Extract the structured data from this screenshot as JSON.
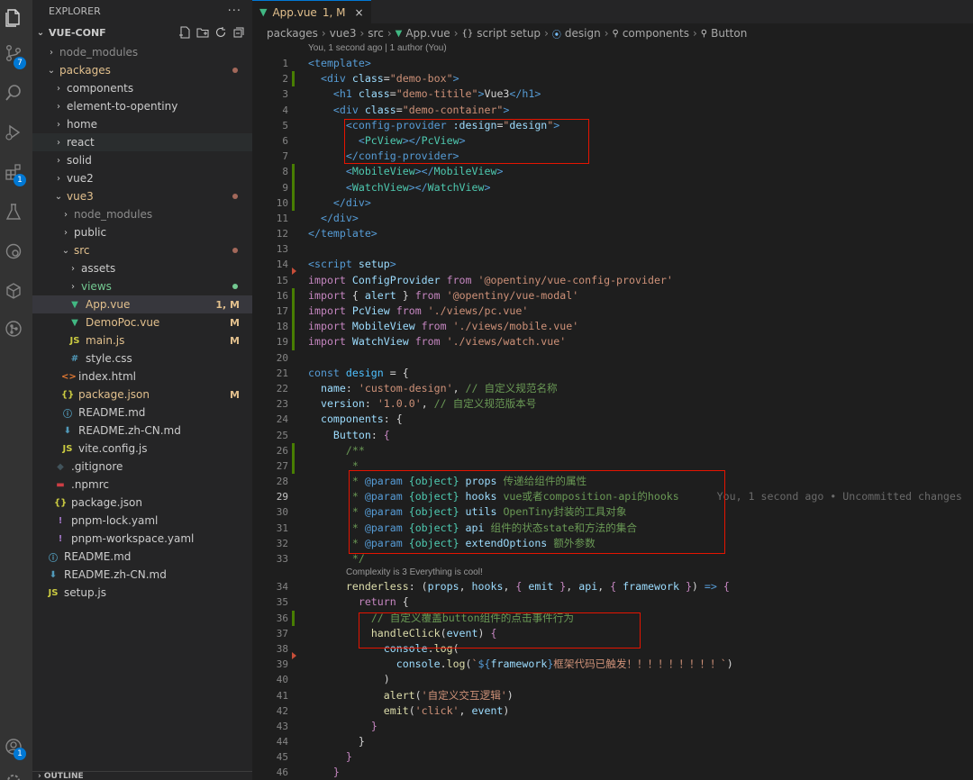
{
  "colors": {
    "accent": "#0078d4",
    "modified": "#e2c08d",
    "added": "#73c991",
    "error_box": "#e51400"
  },
  "activity_bar": {
    "items": [
      {
        "name": "explorer-icon"
      },
      {
        "name": "source-control-icon",
        "badge": "7"
      },
      {
        "name": "search-icon"
      },
      {
        "name": "run-debug-icon"
      },
      {
        "name": "extensions-icon",
        "badge": "1"
      },
      {
        "name": "testing-icon"
      },
      {
        "name": "remote-icon"
      },
      {
        "name": "docker-icon"
      },
      {
        "name": "git-graph-icon"
      }
    ],
    "account_badge": "1"
  },
  "explorer": {
    "title": "EXPLORER",
    "more": "···",
    "root": "VUE-CONF",
    "outline": "OUTLINE",
    "tree": [
      {
        "label": "node_modules",
        "type": "folder",
        "open": false,
        "depth": 1,
        "color": "#8c8c8c"
      },
      {
        "label": "packages",
        "type": "folder",
        "open": true,
        "depth": 1,
        "color": "#e2c08d",
        "dot": "#a3685a"
      },
      {
        "label": "components",
        "type": "folder",
        "open": false,
        "depth": 2
      },
      {
        "label": "element-to-opentiny",
        "type": "folder",
        "open": false,
        "depth": 2
      },
      {
        "label": "home",
        "type": "folder",
        "open": false,
        "depth": 2
      },
      {
        "label": "react",
        "type": "folder",
        "open": false,
        "depth": 2,
        "hover": true
      },
      {
        "label": "solid",
        "type": "folder",
        "open": false,
        "depth": 2
      },
      {
        "label": "vue2",
        "type": "folder",
        "open": false,
        "depth": 2
      },
      {
        "label": "vue3",
        "type": "folder",
        "open": true,
        "depth": 2,
        "color": "#e2c08d",
        "dot": "#a3685a"
      },
      {
        "label": "node_modules",
        "type": "folder",
        "open": false,
        "depth": 3,
        "color": "#8c8c8c"
      },
      {
        "label": "public",
        "type": "folder",
        "open": false,
        "depth": 3
      },
      {
        "label": "src",
        "type": "folder",
        "open": true,
        "depth": 3,
        "color": "#e2c08d",
        "dot": "#a3685a"
      },
      {
        "label": "assets",
        "type": "folder",
        "open": false,
        "depth": 4
      },
      {
        "label": "views",
        "type": "folder",
        "open": false,
        "depth": 4,
        "color": "#73c991",
        "dot": "#73c991"
      },
      {
        "label": "App.vue",
        "type": "vue",
        "depth": 4,
        "color": "#e2c08d",
        "status": "1, M",
        "selected": true
      },
      {
        "label": "DemoPoc.vue",
        "type": "vue",
        "depth": 4,
        "color": "#e2c08d",
        "status": "M"
      },
      {
        "label": "main.js",
        "type": "js",
        "depth": 4,
        "color": "#e2c08d",
        "status": "M"
      },
      {
        "label": "style.css",
        "type": "css",
        "depth": 4
      },
      {
        "label": "index.html",
        "type": "html",
        "depth": 3
      },
      {
        "label": "package.json",
        "type": "json",
        "depth": 3,
        "color": "#e2c08d",
        "status": "M"
      },
      {
        "label": "README.md",
        "type": "info",
        "depth": 3
      },
      {
        "label": "README.zh-CN.md",
        "type": "md",
        "depth": 3
      },
      {
        "label": "vite.config.js",
        "type": "js",
        "depth": 3
      },
      {
        "label": ".gitignore",
        "type": "git",
        "depth": 2
      },
      {
        "label": ".npmrc",
        "type": "npm",
        "depth": 2
      },
      {
        "label": "package.json",
        "type": "json",
        "depth": 2
      },
      {
        "label": "pnpm-lock.yaml",
        "type": "yaml",
        "depth": 2
      },
      {
        "label": "pnpm-workspace.yaml",
        "type": "yaml",
        "depth": 2
      },
      {
        "label": "README.md",
        "type": "info",
        "depth": 1
      },
      {
        "label": "README.zh-CN.md",
        "type": "md",
        "depth": 1
      },
      {
        "label": "setup.js",
        "type": "js",
        "depth": 1
      }
    ]
  },
  "editor": {
    "tab": {
      "label": "App.vue",
      "status": "1, M",
      "close": "×"
    },
    "breadcrumb": [
      "packages",
      "vue3",
      "src",
      "App.vue",
      "script setup",
      "design",
      "components",
      "Button"
    ],
    "blame_header": "You, 1 second ago | 1 author (You)",
    "codelens": "Complexity is 3 Everything is cool!",
    "current_line_blame": "You, 1 second ago • Uncommitted changes",
    "lines": [
      {
        "n": "1",
        "html": "<span class='tg'>&lt;template&gt;</span>"
      },
      {
        "n": "2",
        "gm": "m",
        "html": "  <span class='tg'>&lt;div</span> <span class='an'>class</span><span class='tx'>=</span><span class='st'>\"demo-box\"</span><span class='tg'>&gt;</span>"
      },
      {
        "n": "3",
        "html": "    <span class='tg'>&lt;h1</span> <span class='an'>class</span><span class='tx'>=</span><span class='st'>\"demo-titile\"</span><span class='tg'>&gt;</span><span class='tx'>Vue3</span><span class='tg'>&lt;/h1&gt;</span>"
      },
      {
        "n": "4",
        "html": "    <span class='tg'>&lt;div</span> <span class='an'>class</span><span class='tx'>=</span><span class='st'>\"demo-container\"</span><span class='tg'>&gt;</span>"
      },
      {
        "n": "5",
        "html": "      <span class='tg'>&lt;config-provider</span> <span class='an'>:design</span><span class='tx'>=</span><span class='st'>\"</span><span class='vr'>design</span><span class='st'>\"</span><span class='tg'>&gt;</span>"
      },
      {
        "n": "6",
        "html": "        <span class='tg'>&lt;</span><span class='cy'>PcView</span><span class='tg'>&gt;&lt;/</span><span class='cy'>PcView</span><span class='tg'>&gt;</span>"
      },
      {
        "n": "7",
        "html": "      <span class='tg'>&lt;/config-provider&gt;</span>"
      },
      {
        "n": "8",
        "gm": "m",
        "html": "      <span class='tg'>&lt;</span><span class='cy'>MobileView</span><span class='tg'>&gt;&lt;/</span><span class='cy'>MobileView</span><span class='tg'>&gt;</span>"
      },
      {
        "n": "9",
        "gm": "m",
        "html": "      <span class='tg'>&lt;</span><span class='cy'>WatchView</span><span class='tg'>&gt;&lt;/</span><span class='cy'>WatchView</span><span class='tg'>&gt;</span>"
      },
      {
        "n": "10",
        "gm": "m",
        "html": "    <span class='tg'>&lt;/div&gt;</span>"
      },
      {
        "n": "11",
        "html": "  <span class='tg'>&lt;/div&gt;</span>"
      },
      {
        "n": "12",
        "html": "<span class='tg'>&lt;/template&gt;</span>"
      },
      {
        "n": "13",
        "html": ""
      },
      {
        "n": "14",
        "gm": "d",
        "html": "<span class='tg'>&lt;script</span> <span class='an'>setup</span><span class='tg'>&gt;</span>"
      },
      {
        "n": "15",
        "html": "<span class='kw'>import</span> <span class='vr'>ConfigProvider</span> <span class='kw'>from</span> <span class='st'>'@opentiny/vue-config-provider'</span>"
      },
      {
        "n": "16",
        "gm": "m",
        "html": "<span class='kw'>import</span> <span class='pn'>{</span> <span class='vr'>alert</span> <span class='pn'>}</span> <span class='kw'>from</span> <span class='st'>'@opentiny/vue-modal'</span>"
      },
      {
        "n": "17",
        "gm": "m",
        "html": "<span class='kw'>import</span> <span class='vr'>PcView</span> <span class='kw'>from</span> <span class='st'>'./views/pc.vue'</span>"
      },
      {
        "n": "18",
        "gm": "m",
        "html": "<span class='kw'>import</span> <span class='vr'>MobileView</span> <span class='kw'>from</span> <span class='st'>'./views/mobile.vue'</span>"
      },
      {
        "n": "19",
        "gm": "m",
        "html": "<span class='kw'>import</span> <span class='vr'>WatchView</span> <span class='kw'>from</span> <span class='st'>'./views/watch.vue'</span>"
      },
      {
        "n": "20",
        "html": ""
      },
      {
        "n": "21",
        "html": "<span class='kb'>const</span> <span class='cn'>design</span> <span class='tx'>=</span> <span class='pn'>{</span>"
      },
      {
        "n": "22",
        "html": "  <span class='vr'>name</span><span class='tx'>:</span> <span class='st'>'custom-design'</span><span class='tx'>,</span> <span class='cm'>// 自定义规范名称</span>"
      },
      {
        "n": "23",
        "html": "  <span class='vr'>version</span><span class='tx'>:</span> <span class='st'>'1.0.0'</span><span class='tx'>,</span> <span class='cm'>// 自定义规范版本号</span>"
      },
      {
        "n": "24",
        "html": "  <span class='vr'>components</span><span class='tx'>:</span> <span class='pn'>{</span>"
      },
      {
        "n": "25",
        "html": "    <span class='vr'>Button</span><span class='tx'>:</span> <span class='kw'>{</span>"
      },
      {
        "n": "26",
        "gm": "m",
        "html": "      <span class='cm'>/**</span>"
      },
      {
        "n": "27",
        "gm": "m",
        "html": "       <span class='cm'>*</span>"
      },
      {
        "n": "28",
        "html": "       <span class='cm'>* </span><span class='jd'>@param</span> <span class='cy'>{object}</span> <span class='vr'>props</span> <span class='cm'>传递给组件的属性</span>"
      },
      {
        "n": "29",
        "cur": true,
        "html": "       <span class='cm'>* </span><span class='jd'>@param</span> <span class='cy'>{object}</span> <span class='vr'>hooks</span> <span class='cm'>vue或者composition-api的hooks</span>"
      },
      {
        "n": "30",
        "html": "       <span class='cm'>* </span><span class='jd'>@param</span> <span class='cy'>{object}</span> <span class='vr'>utils</span> <span class='cm'>OpenTiny封装的工具对象</span>"
      },
      {
        "n": "31",
        "html": "       <span class='cm'>* </span><span class='jd'>@param</span> <span class='cy'>{object}</span> <span class='vr'>api</span> <span class='cm'>组件的状态state和方法的集合</span>"
      },
      {
        "n": "32",
        "html": "       <span class='cm'>* </span><span class='jd'>@param</span> <span class='cy'>{object}</span> <span class='vr'>extendOptions</span> <span class='cm'>额外参数</span>"
      },
      {
        "n": "33",
        "html": "       <span class='cm'>*/</span>"
      },
      {
        "n": "34",
        "lens": true,
        "html": "      <span class='fn'>renderless</span><span class='tx'>:</span> <span class='tx'>(</span><span class='vr'>props</span><span class='tx'>, </span><span class='vr'>hooks</span><span class='tx'>, </span><span class='kw'>{</span> <span class='vr'>emit</span> <span class='kw'>}</span><span class='tx'>, </span><span class='vr'>api</span><span class='tx'>, </span><span class='kw'>{</span> <span class='vr'>framework</span> <span class='kw'>}</span><span class='tx'>)</span> <span class='kb'>=&gt;</span> <span class='kw'>{</span>"
      },
      {
        "n": "35",
        "html": "        <span class='kw'>return</span> <span class='pn'>{</span>"
      },
      {
        "n": "36",
        "gm": "m",
        "html": "          <span class='cm'>// 自定义覆盖button组件的点击事件行为</span>"
      },
      {
        "n": "37",
        "html": "          <span class='fn'>handleClick</span><span class='tx'>(</span><span class='vr'>event</span><span class='tx'>)</span> <span class='kw'>{</span>"
      },
      {
        "n": "38",
        "gm": "d",
        "html": "            <span class='vr'>console</span><span class='tx'>.</span><span class='fn'>log</span><span class='tx'>(</span>"
      },
      {
        "n": "39",
        "html": "              <span class='vr'>console</span><span class='tx'>.</span><span class='fn'>log</span><span class='tx'>(</span><span class='st'>`</span><span class='kb'>${</span><span class='vr'>framework</span><span class='kb'>}</span><span class='st'>框架代码已触发！！！！！！！！！`</span><span class='tx'>)</span>"
      },
      {
        "n": "40",
        "html": "            <span class='tx'>)</span>"
      },
      {
        "n": "41",
        "html": "            <span class='fn'>alert</span><span class='tx'>(</span><span class='st'>'自定义交互逻辑'</span><span class='tx'>)</span>"
      },
      {
        "n": "42",
        "html": "            <span class='fn'>emit</span><span class='tx'>(</span><span class='st'>'click'</span><span class='tx'>, </span><span class='vr'>event</span><span class='tx'>)</span>"
      },
      {
        "n": "43",
        "html": "          <span class='kw'>}</span>"
      },
      {
        "n": "44",
        "html": "        <span class='pn'>}</span>"
      },
      {
        "n": "45",
        "html": "      <span class='kw'>}</span>"
      },
      {
        "n": "46",
        "html": "    <span class='kw'>}</span>"
      }
    ]
  }
}
